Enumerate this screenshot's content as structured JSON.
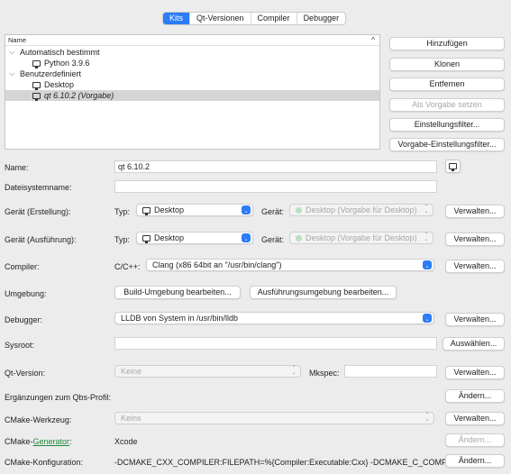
{
  "tabs": [
    "Kits",
    "Qt-Versionen",
    "Compiler",
    "Debugger"
  ],
  "kit_list": {
    "header": "Name",
    "sort_indicator": "^",
    "groups": [
      {
        "label": "Automatisch bestimmt",
        "items": [
          "Python 3.9.6"
        ]
      },
      {
        "label": "Benutzerdefiniert",
        "items": [
          "Desktop",
          "qt 6.10.2 (Vorgabe)"
        ]
      }
    ]
  },
  "side_buttons": {
    "add": "Hinzufügen",
    "clone": "Klonen",
    "remove": "Entfernen",
    "make_default": "Als Vorgabe setzen",
    "settings_filter": "Einstellungsfilter...",
    "default_settings_filter": "Vorgabe-Einstellungsfilter..."
  },
  "form": {
    "name_label": "Name:",
    "name_value": "qt 6.10.2",
    "fs_name_label": "Dateisystemname:",
    "build_device_label": "Gerät (Erstellung):",
    "run_device_label": "Gerät (Ausführung):",
    "typ_label": "Typ:",
    "geraet_label": "Gerät:",
    "device_type": "Desktop",
    "device_value": "Desktop (Vorgabe für Desktop)",
    "compiler_label": "Compiler:",
    "cpp_label": "C/C++:",
    "compiler_value": "Clang (x86 64bit an \"/usr/bin/clang\")",
    "env_label": "Umgebung:",
    "build_env_button": "Build-Umgebung bearbeiten...",
    "run_env_button": "Ausführungsumgebung bearbeiten...",
    "debugger_label": "Debugger:",
    "debugger_value": "LLDB von System in /usr/bin/lldb",
    "sysroot_label": "Sysroot:",
    "qt_version_label": "Qt-Version:",
    "qt_version_value": "Keine",
    "mkspec_label": "Mkspec:",
    "qbs_label": "Ergänzungen zum Qbs-Profil:",
    "cmake_tool_label": "CMake-Werkzeug:",
    "cmake_tool_value": "Keins",
    "cmake_gen_label_prefix": "CMake-",
    "cmake_gen_label_link": "Generator",
    "cmake_gen_label_suffix": ":",
    "cmake_gen_value": "Xcode",
    "cmake_config_label": "CMake-Konfiguration:",
    "cmake_config_value": "-DCMAKE_CXX_COMPILER:FILEPATH=%{Compiler:Executable:Cxx} -DCMAKE_C_COMP...",
    "manage": "Verwalten...",
    "browse": "Auswählen...",
    "change": "Ändern..."
  }
}
